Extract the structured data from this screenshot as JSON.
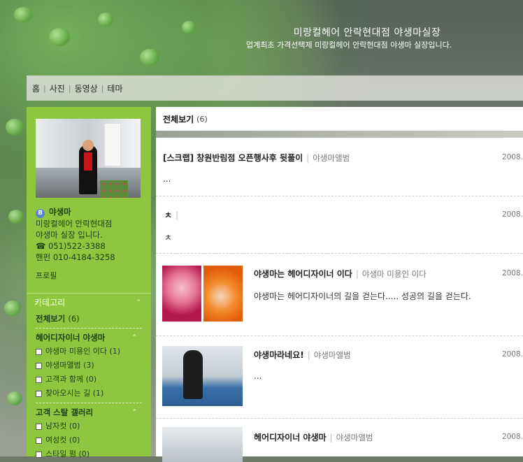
{
  "header": {
    "title": "미랑컬헤어 안락현대점 야생마실장",
    "description": "업계최초 가격선택제 미랑컬헤어 안락현대점 야생마 실장입니다."
  },
  "nav": {
    "items": [
      "홈",
      "사진",
      "동영상",
      "테마"
    ],
    "separator": "|"
  },
  "profile": {
    "badge": "B",
    "nickname": "야생마",
    "line1": "미랑컬헤어 안락현대점",
    "line2": "야생마 실장 입니다.",
    "phone": "☎ 051)522-3388",
    "mobile": "핸펀 010-4184-3258",
    "profile_link": "프로필"
  },
  "category": {
    "header": "카테고리",
    "all": {
      "label": "전체보기",
      "count": "(6)"
    },
    "group1": {
      "label": "헤어디자이너 야생마",
      "items": [
        {
          "label": "야생마 미용인 이다",
          "count": "(1)"
        },
        {
          "label": "야생마앨범",
          "count": "(3)"
        },
        {
          "label": "고객과 함께",
          "count": "(0)"
        },
        {
          "label": "찾아오시는 길",
          "count": "(1)"
        }
      ]
    },
    "group2": {
      "label": "고객 스탈 갤러리",
      "items": [
        {
          "label": "남자컷",
          "count": "(0)"
        },
        {
          "label": "여성컷",
          "count": "(0)"
        },
        {
          "label": "스타일 펌",
          "count": "(0)"
        }
      ]
    },
    "caret": "⌃"
  },
  "main": {
    "header_label": "전체보기",
    "header_count": "(6)",
    "posts": [
      {
        "title": "[스크랩] 창원반림점 오픈행사후 뒷풀이",
        "category": "야생마앨범",
        "date": "2008.",
        "excerpt": "..."
      },
      {
        "title": "ㅊ",
        "category": "",
        "date": "2008.",
        "excerpt": "ㅊ"
      },
      {
        "title": "야생마는 헤어디자이너 이다",
        "category": "야생마 미용인 이다",
        "date": "2008.",
        "excerpt": "야생마는 헤어디자이너의 길을 걷는다..... 성공의 길을 걷는다."
      },
      {
        "title": "야생마라네요!",
        "category": "야생마앨범",
        "date": "2008.",
        "excerpt": "..."
      },
      {
        "title": "헤어디자이너 야생마",
        "category": "야생마앨범",
        "date": "2008.",
        "excerpt": ""
      }
    ]
  }
}
